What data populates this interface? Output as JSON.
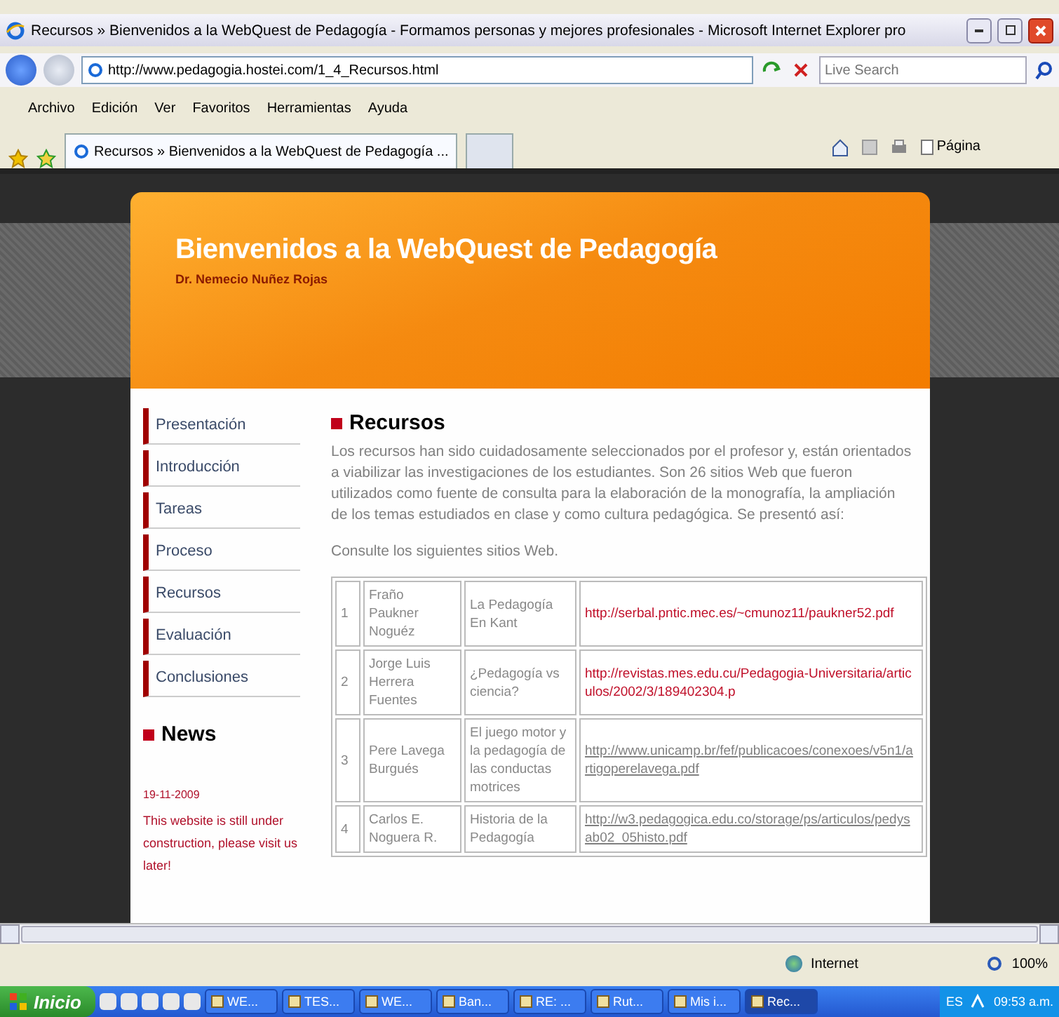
{
  "window": {
    "title": "Recursos » Bienvenidos a la WebQuest de Pedagogía - Formamos personas y mejores profesionales - Microsoft Internet Explorer pro"
  },
  "address_bar": {
    "url": "http://www.pedagogia.hostei.com/1_4_Recursos.html",
    "search_placeholder": "Live Search"
  },
  "menu": [
    "Archivo",
    "Edición",
    "Ver",
    "Favoritos",
    "Herramientas",
    "Ayuda"
  ],
  "tabs": [
    {
      "label": "Recursos » Bienvenidos a la WebQuest de Pedagogía ...",
      "selected": true
    }
  ],
  "command_bar": {
    "page_menu": "Página"
  },
  "page": {
    "header": {
      "title": "Bienvenidos a la WebQuest de Pedagogía",
      "subtitle": "Dr. Nemecio Nuñez Rojas"
    },
    "nav": [
      "Presentación",
      "Introducción",
      "Tareas",
      "Proceso",
      "Recursos",
      "Evaluación",
      "Conclusiones"
    ],
    "news": {
      "heading": "News",
      "date": "19-11-2009",
      "message": "This website is still under construction, please visit us later!"
    },
    "section": {
      "heading": "Recursos",
      "paragraph": "Los recursos han sido cuidadosamente seleccionados por el profesor y, están orientados a viabilizar las investigaciones de los estudiantes. Son 26 sitios Web que fueron utilizados como fuente de consulta para la elaboración de la monografía, la ampliación de los temas estudiados en clase y como cultura pedagógica. Se presentó así:",
      "note": "Consulte los siguientes sitios Web."
    },
    "table": {
      "rows": [
        {
          "number": "1",
          "author": "Fraño Paukner Noguéz",
          "title": "La Pedagogía En Kant",
          "url": "http://serbal.pntic.mec.es/~cmunoz11/paukner52.pdf",
          "underlined": false
        },
        {
          "number": "2",
          "author": "Jorge Luis Herrera Fuentes",
          "title": "¿Pedagogía vs ciencia?",
          "url": "http://revistas.mes.edu.cu/Pedagogia-Universitaria/articulos/2002/3/189402304.p",
          "underlined": false
        },
        {
          "number": "3",
          "author": "Pere Lavega Burgués",
          "title": "El juego motor y la pedagogía de las conductas motrices",
          "url": "http://www.unicamp.br/fef/publicacoes/conexoes/v5n1/artigoperelavega.pdf",
          "underlined": true
        },
        {
          "number": "4",
          "author": "Carlos E. Noguera R.",
          "title": "Historia de la Pedagogía",
          "url": "http://w3.pedagogica.edu.co/storage/ps/articulos/pedysab02_05histo.pdf",
          "underlined": true
        }
      ]
    }
  },
  "status_bar": {
    "zone": "Internet",
    "zoom": "100%"
  },
  "taskbar": {
    "start": "Inicio",
    "tasks": [
      {
        "label": "WE...",
        "selected": false
      },
      {
        "label": "TES...",
        "selected": false
      },
      {
        "label": "WE...",
        "selected": false
      },
      {
        "label": "Ban...",
        "selected": false
      },
      {
        "label": "RE: ...",
        "selected": false
      },
      {
        "label": "Rut...",
        "selected": false
      },
      {
        "label": "Mis i...",
        "selected": false
      },
      {
        "label": "Rec...",
        "selected": true
      }
    ],
    "language": "ES",
    "clock": "09:53 a.m."
  }
}
